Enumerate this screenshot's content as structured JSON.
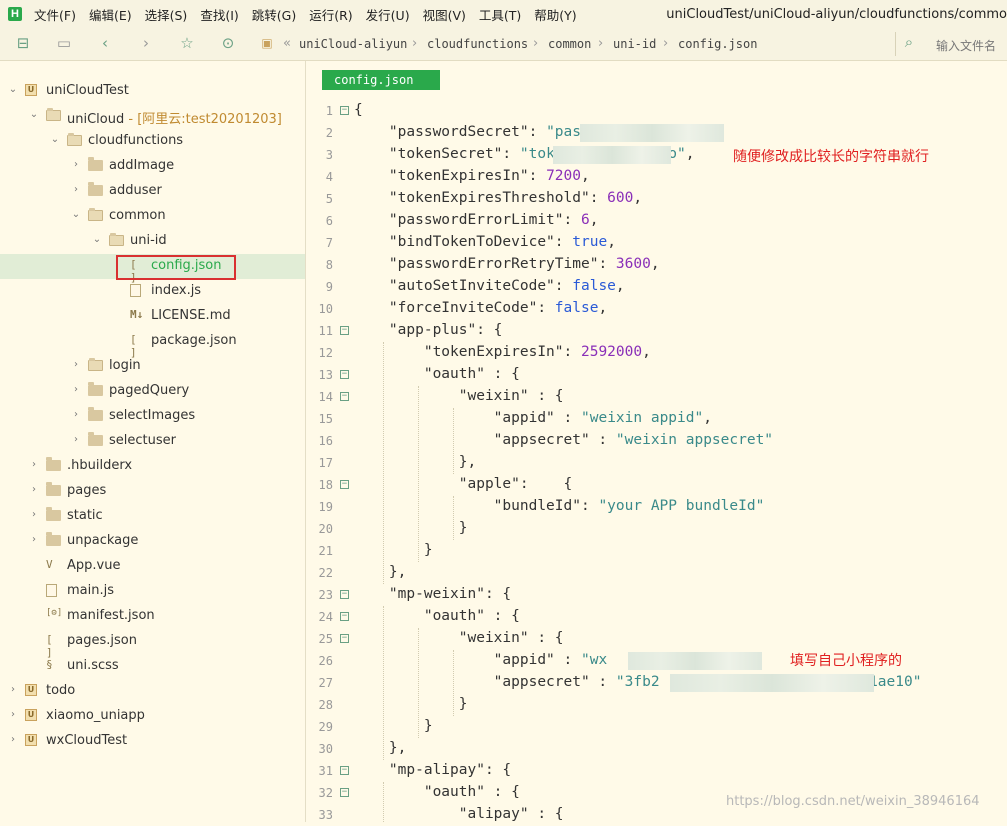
{
  "menu": {
    "items": [
      "文件(F)",
      "编辑(E)",
      "选择(S)",
      "查找(I)",
      "跳转(G)",
      "运行(R)",
      "发行(U)",
      "视图(V)",
      "工具(T)",
      "帮助(Y)"
    ],
    "window_title": "uniCloudTest/uniCloud-aliyun/cloudfunctions/commo"
  },
  "toolbar": {
    "breadcrumb": [
      "uniCloud-aliyun",
      "cloudfunctions",
      "common",
      "uni-id",
      "config.json"
    ],
    "search_placeholder": "输入文件名"
  },
  "sidebar": {
    "rows": [
      {
        "label": "uniCloudTest",
        "arrow": "˅",
        "icon": "project",
        "depth": 0
      },
      {
        "label": "uniCloud",
        "badge": " - [阿里云:test20201203]",
        "arrow": "˅",
        "icon": "folder-open",
        "depth": 1
      },
      {
        "label": "cloudfunctions",
        "arrow": "˅",
        "icon": "folder-open",
        "depth": 2
      },
      {
        "label": "addImage",
        "arrow": "›",
        "icon": "folder",
        "depth": 3
      },
      {
        "label": "adduser",
        "arrow": "›",
        "icon": "folder",
        "depth": 3
      },
      {
        "label": "common",
        "arrow": "˅",
        "icon": "folder-open",
        "depth": 3
      },
      {
        "label": "uni-id",
        "arrow": "˅",
        "icon": "folder-open",
        "depth": 4
      },
      {
        "label": "config.json",
        "icon": "json",
        "depth": 5,
        "selected": true
      },
      {
        "label": "index.js",
        "icon": "file",
        "depth": 5
      },
      {
        "label": "LICENSE.md",
        "icon": "markdown",
        "depth": 5
      },
      {
        "label": "package.json",
        "icon": "json",
        "depth": 5
      },
      {
        "label": "login",
        "arrow": "›",
        "icon": "folder-open",
        "depth": 3
      },
      {
        "label": "pagedQuery",
        "arrow": "›",
        "icon": "folder",
        "depth": 3
      },
      {
        "label": "selectImages",
        "arrow": "›",
        "icon": "folder",
        "depth": 3
      },
      {
        "label": "selectuser",
        "arrow": "›",
        "icon": "folder",
        "depth": 3
      },
      {
        "label": ".hbuilderx",
        "arrow": "›",
        "icon": "folder",
        "depth": 1
      },
      {
        "label": "pages",
        "arrow": "›",
        "icon": "folder",
        "depth": 1
      },
      {
        "label": "static",
        "arrow": "›",
        "icon": "folder",
        "depth": 1
      },
      {
        "label": "unpackage",
        "arrow": "›",
        "icon": "folder",
        "depth": 1
      },
      {
        "label": "App.vue",
        "icon": "vue",
        "depth": 1
      },
      {
        "label": "main.js",
        "icon": "file",
        "depth": 1
      },
      {
        "label": "manifest.json",
        "icon": "manifest",
        "depth": 1
      },
      {
        "label": "pages.json",
        "icon": "json",
        "depth": 1
      },
      {
        "label": "uni.scss",
        "icon": "scss",
        "depth": 1
      },
      {
        "label": "todo",
        "arrow": "›",
        "icon": "project",
        "depth": 0
      },
      {
        "label": "xiaomo_uniapp",
        "arrow": "›",
        "icon": "project",
        "depth": 0
      },
      {
        "label": "wxCloudTest",
        "arrow": "›",
        "icon": "project",
        "depth": 0
      }
    ]
  },
  "editor": {
    "tab_label": "config.json",
    "lines": [
      [
        [
          "p",
          "{"
        ]
      ],
      [
        [
          "k",
          "    \"passwordSecret\""
        ],
        [
          "p",
          ": "
        ],
        [
          "s",
          "\"pas            mo\""
        ],
        [
          "p",
          ","
        ]
      ],
      [
        [
          "k",
          "    \"tokenSecret\""
        ],
        [
          "p",
          ": "
        ],
        [
          "s",
          "\"tok            mo\""
        ],
        [
          "p",
          ","
        ]
      ],
      [
        [
          "k",
          "    \"tokenExpiresIn\""
        ],
        [
          "p",
          ": "
        ],
        [
          "n",
          "7200"
        ],
        [
          "p",
          ","
        ]
      ],
      [
        [
          "k",
          "    \"tokenExpiresThreshold\""
        ],
        [
          "p",
          ": "
        ],
        [
          "n",
          "600"
        ],
        [
          "p",
          ","
        ]
      ],
      [
        [
          "k",
          "    \"passwordErrorLimit\""
        ],
        [
          "p",
          ": "
        ],
        [
          "n",
          "6"
        ],
        [
          "p",
          ","
        ]
      ],
      [
        [
          "k",
          "    \"bindTokenToDevice\""
        ],
        [
          "p",
          ": "
        ],
        [
          "b",
          "true"
        ],
        [
          "p",
          ","
        ]
      ],
      [
        [
          "k",
          "    \"passwordErrorRetryTime\""
        ],
        [
          "p",
          ": "
        ],
        [
          "n",
          "3600"
        ],
        [
          "p",
          ","
        ]
      ],
      [
        [
          "k",
          "    \"autoSetInviteCode\""
        ],
        [
          "p",
          ": "
        ],
        [
          "b",
          "false"
        ],
        [
          "p",
          ","
        ]
      ],
      [
        [
          "k",
          "    \"forceInviteCode\""
        ],
        [
          "p",
          ": "
        ],
        [
          "b",
          "false"
        ],
        [
          "p",
          ","
        ]
      ],
      [
        [
          "k",
          "    \"app-plus\""
        ],
        [
          "p",
          ": {"
        ]
      ],
      [
        [
          "k",
          "        \"tokenExpiresIn\""
        ],
        [
          "p",
          ": "
        ],
        [
          "n",
          "2592000"
        ],
        [
          "p",
          ","
        ]
      ],
      [
        [
          "k",
          "        \"oauth\""
        ],
        [
          "p",
          " : {"
        ]
      ],
      [
        [
          "k",
          "            \"weixin\""
        ],
        [
          "p",
          " : {"
        ]
      ],
      [
        [
          "k",
          "                \"appid\""
        ],
        [
          "p",
          " : "
        ],
        [
          "s",
          "\"weixin appid\""
        ],
        [
          "p",
          ","
        ]
      ],
      [
        [
          "k",
          "                \"appsecret\""
        ],
        [
          "p",
          " : "
        ],
        [
          "s",
          "\"weixin appsecret\""
        ]
      ],
      [
        [
          "p",
          "            },"
        ]
      ],
      [
        [
          "k",
          "            \"apple\""
        ],
        [
          "p",
          ":    {"
        ]
      ],
      [
        [
          "k",
          "                \"bundleId\""
        ],
        [
          "p",
          ": "
        ],
        [
          "s",
          "\"your APP bundleId\""
        ]
      ],
      [
        [
          "p",
          "            }"
        ]
      ],
      [
        [
          "p",
          "        }"
        ]
      ],
      [
        [
          "p",
          "    },"
        ]
      ],
      [
        [
          "k",
          "    \"mp-weixin\""
        ],
        [
          "p",
          ": {"
        ]
      ],
      [
        [
          "k",
          "        \"oauth\""
        ],
        [
          "p",
          " : {"
        ]
      ],
      [
        [
          "k",
          "            \"weixin\""
        ],
        [
          "p",
          " : {"
        ]
      ],
      [
        [
          "k",
          "                \"appid\""
        ],
        [
          "p",
          " : "
        ],
        [
          "s",
          "\"wx            323\""
        ],
        [
          "p",
          ","
        ]
      ],
      [
        [
          "k",
          "                \"appsecret\""
        ],
        [
          "p",
          " : "
        ],
        [
          "s",
          "\"3fb2                        1ae10\""
        ]
      ],
      [
        [
          "p",
          "            }"
        ]
      ],
      [
        [
          "p",
          "        }"
        ]
      ],
      [
        [
          "p",
          "    },"
        ]
      ],
      [
        [
          "k",
          "    \"mp-alipay\""
        ],
        [
          "p",
          ": {"
        ]
      ],
      [
        [
          "k",
          "        \"oauth\""
        ],
        [
          "p",
          " : {"
        ]
      ],
      [
        [
          "k",
          "            \"alipay\""
        ],
        [
          "p",
          " : {"
        ]
      ]
    ],
    "foldable_lines": [
      1,
      11,
      13,
      14,
      18,
      23,
      24,
      25,
      31,
      32
    ],
    "notes": {
      "note1": "随便修改成比较长的字符串就行",
      "note2": "填写自己小程序的"
    }
  },
  "watermark": "https://blog.csdn.net/weixin_38946164"
}
